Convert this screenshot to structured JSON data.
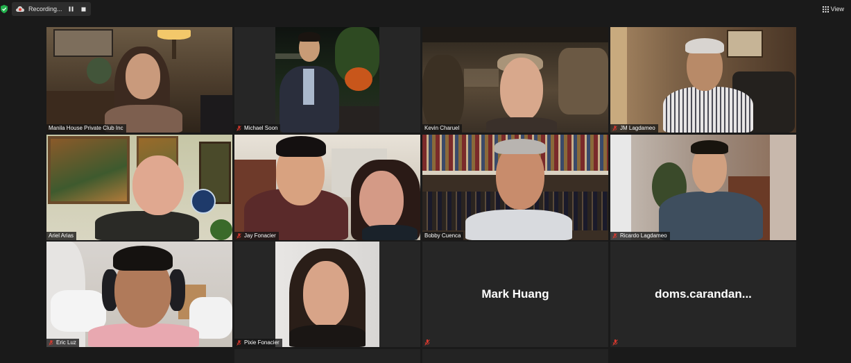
{
  "toolbar": {
    "security_icon": "shield-icon",
    "recording_label": "Recording...",
    "view_label": "View"
  },
  "colors": {
    "background": "#1a1a1a",
    "tile_background": "#262626",
    "active_speaker_border": "#c3e35a",
    "muted_icon": "#e03a2f"
  },
  "participants": [
    {
      "name": "Manila House Private Club Inc",
      "muted": false,
      "video": true,
      "active_speaker": true
    },
    {
      "name": "Michael Soon",
      "muted": true,
      "video": true
    },
    {
      "name": "Kevin Charuel",
      "muted": false,
      "video": true
    },
    {
      "name": "JM Lagdameo",
      "muted": true,
      "video": true
    },
    {
      "name": "Ariel Arias",
      "muted": false,
      "video": true
    },
    {
      "name": "Jay Fonacier",
      "muted": true,
      "video": true
    },
    {
      "name": "Bobby Cuenca",
      "muted": false,
      "video": true
    },
    {
      "name": "Ricardo Lagdameo",
      "muted": true,
      "video": true
    },
    {
      "name": "Eric Luz",
      "muted": true,
      "video": true
    },
    {
      "name": "Pixie Fonacier",
      "muted": true,
      "video": true
    },
    {
      "name": "Mark Huang",
      "muted": true,
      "video": false
    },
    {
      "name": "doms.carandan...",
      "muted": true,
      "video": false
    }
  ]
}
